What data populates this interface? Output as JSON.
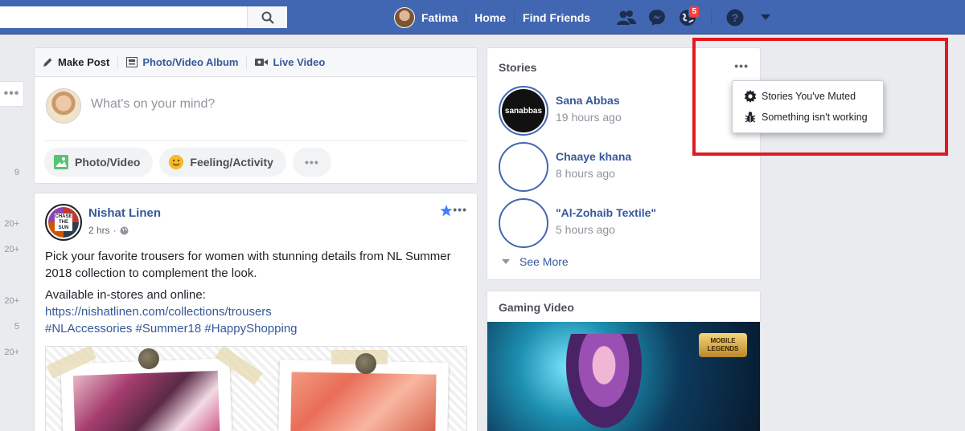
{
  "header": {
    "user_name": "Fatima",
    "home_label": "Home",
    "find_friends_label": "Find Friends",
    "notification_count": "5"
  },
  "gutter": {
    "counts": [
      "9",
      "20+",
      "20+",
      "20+",
      "5",
      "20+"
    ]
  },
  "composer": {
    "tabs": [
      "Make Post",
      "Photo/Video Album",
      "Live Video"
    ],
    "placeholder": "What's on your mind?",
    "actions": [
      "Photo/Video",
      "Feeling/Activity"
    ]
  },
  "post": {
    "author": "Nishat Linen",
    "time": "2 hrs",
    "text_1": "Pick your favorite trousers for women with stunning details from NL Summer 2018 collection to complement the look.",
    "text_2": "Available in-stores and online:",
    "link": "https://nishatlinen.com/collections/trousers",
    "hashtags": "#NLAccessories #Summer18 #HappyShopping"
  },
  "stories": {
    "title": "Stories",
    "items": [
      {
        "name": "Sana Abbas",
        "time": "19 hours ago",
        "thumb_text": "sanabbas"
      },
      {
        "name": "Chaaye khana",
        "time": "8 hours ago"
      },
      {
        "name": "\"Al-Zohaib Textile\"",
        "time": "5 hours ago"
      }
    ],
    "see_more": "See More"
  },
  "stories_menu": {
    "item_1": "Stories You've Muted",
    "item_2": "Something isn't working"
  },
  "gaming": {
    "title": "Gaming Video",
    "logo_text": "MOBILE LEGENDS"
  },
  "colors": {
    "brand_blue": "#4267b2",
    "link_blue": "#365899",
    "highlight_red": "#e01a22",
    "badge_red": "#fa3e3e"
  }
}
